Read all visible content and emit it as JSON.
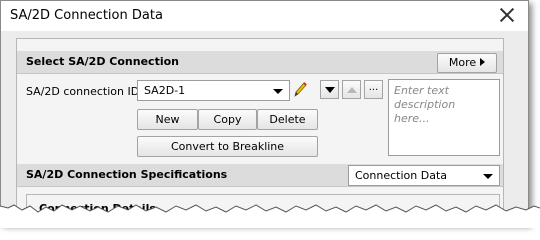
{
  "window": {
    "title": "SA/2D Connection Data"
  },
  "select_section": {
    "title": "Select SA/2D Connection",
    "more_label": "More",
    "id_label": "SA/2D connection ID:",
    "id_value": "SA2D-1",
    "description_placeholder": "Enter text description here...",
    "buttons": {
      "new": "New",
      "copy": "Copy",
      "delete": "Delete",
      "convert": "Convert to Breakline"
    },
    "dots_label": "..."
  },
  "spec_section": {
    "title": "SA/2D Connection Specifications",
    "dropdown_value": "Connection Data"
  },
  "details_group": {
    "label": "Connection Details"
  },
  "colors": {
    "accent_pencil": "#e0a300"
  }
}
